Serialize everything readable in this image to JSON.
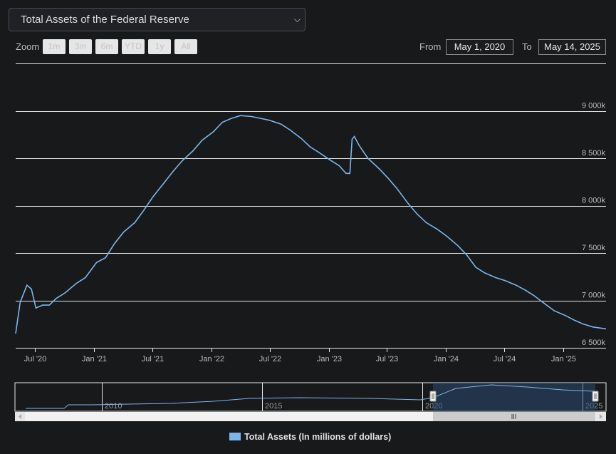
{
  "selector": {
    "value": "Total Assets of the Federal Reserve"
  },
  "zoom": {
    "label": "Zoom",
    "buttons": [
      "1m",
      "3m",
      "6m",
      "YTD",
      "1y",
      "All"
    ]
  },
  "range": {
    "from_label": "From",
    "from_value": "May 1, 2020",
    "to_label": "To",
    "to_value": "May 14, 2025"
  },
  "legend": {
    "label": "Total Assets (In millions of dollars)"
  },
  "colors": {
    "series": "#7cb5ec",
    "grid": "#e6e6e6",
    "background": "#18191b"
  },
  "chart_data": {
    "type": "line",
    "title": "Total Assets of the Federal Reserve",
    "xlabel": "",
    "ylabel": "",
    "xlim": [
      "2020-05-01",
      "2025-05-14"
    ],
    "ylim": [
      6500,
      9500
    ],
    "y_unit": "millions of dollars (axis shown in k)",
    "x_tick_labels": [
      "Jul '20",
      "Jan '21",
      "Jul '21",
      "Jan '22",
      "Jul '22",
      "Jan '23",
      "Jul '23",
      "Jan '24",
      "Jul '24",
      "Jan '25"
    ],
    "y_ticks": [
      6500,
      7000,
      7500,
      8000,
      8500,
      9000
    ],
    "y_tick_labels": [
      "6 500k",
      "7 000k",
      "7 500k",
      "8 000k",
      "8 500k",
      "9 000k"
    ],
    "legend_placement": "bottom-center",
    "grid": true,
    "series": [
      {
        "name": "Total Assets (In millions of dollars)",
        "points": [
          [
            "2020-05-01",
            6650
          ],
          [
            "2020-05-15",
            6980
          ],
          [
            "2020-06-05",
            7160
          ],
          [
            "2020-06-19",
            7120
          ],
          [
            "2020-07-03",
            6920
          ],
          [
            "2020-07-24",
            6950
          ],
          [
            "2020-08-14",
            6950
          ],
          [
            "2020-09-04",
            7020
          ],
          [
            "2020-10-02",
            7080
          ],
          [
            "2020-11-06",
            7180
          ],
          [
            "2020-12-04",
            7240
          ],
          [
            "2021-01-08",
            7400
          ],
          [
            "2021-02-05",
            7450
          ],
          [
            "2021-03-05",
            7600
          ],
          [
            "2021-04-02",
            7720
          ],
          [
            "2021-05-07",
            7820
          ],
          [
            "2021-06-04",
            7950
          ],
          [
            "2021-07-02",
            8090
          ],
          [
            "2021-08-06",
            8240
          ],
          [
            "2021-09-03",
            8360
          ],
          [
            "2021-10-01",
            8470
          ],
          [
            "2021-11-05",
            8580
          ],
          [
            "2021-12-03",
            8690
          ],
          [
            "2022-01-07",
            8780
          ],
          [
            "2022-02-04",
            8880
          ],
          [
            "2022-03-04",
            8920
          ],
          [
            "2022-04-01",
            8950
          ],
          [
            "2022-05-06",
            8940
          ],
          [
            "2022-06-03",
            8920
          ],
          [
            "2022-07-01",
            8900
          ],
          [
            "2022-08-05",
            8860
          ],
          [
            "2022-09-02",
            8800
          ],
          [
            "2022-10-07",
            8710
          ],
          [
            "2022-11-04",
            8620
          ],
          [
            "2022-12-02",
            8560
          ],
          [
            "2023-01-06",
            8480
          ],
          [
            "2023-02-03",
            8420
          ],
          [
            "2023-02-24",
            8340
          ],
          [
            "2023-03-08",
            8340
          ],
          [
            "2023-03-15",
            8700
          ],
          [
            "2023-03-22",
            8730
          ],
          [
            "2023-04-05",
            8640
          ],
          [
            "2023-05-03",
            8500
          ],
          [
            "2023-06-07",
            8390
          ],
          [
            "2023-07-05",
            8290
          ],
          [
            "2023-08-02",
            8180
          ],
          [
            "2023-09-06",
            8020
          ],
          [
            "2023-10-04",
            7910
          ],
          [
            "2023-11-01",
            7820
          ],
          [
            "2023-12-06",
            7750
          ],
          [
            "2024-01-03",
            7680
          ],
          [
            "2024-02-07",
            7580
          ],
          [
            "2024-03-06",
            7480
          ],
          [
            "2024-04-03",
            7350
          ],
          [
            "2024-05-01",
            7290
          ],
          [
            "2024-06-05",
            7240
          ],
          [
            "2024-07-03",
            7210
          ],
          [
            "2024-08-07",
            7160
          ],
          [
            "2024-09-04",
            7110
          ],
          [
            "2024-10-02",
            7050
          ],
          [
            "2024-11-06",
            6960
          ],
          [
            "2024-12-04",
            6890
          ],
          [
            "2025-01-08",
            6840
          ],
          [
            "2025-02-05",
            6790
          ],
          [
            "2025-03-05",
            6750
          ],
          [
            "2025-04-02",
            6720
          ],
          [
            "2025-05-14",
            6700
          ]
        ]
      }
    ],
    "navigator": {
      "x_tick_labels": [
        "2010",
        "2015",
        "2020",
        "2025"
      ],
      "selected_range": [
        "2020-05-01",
        "2025-05-14"
      ]
    }
  }
}
